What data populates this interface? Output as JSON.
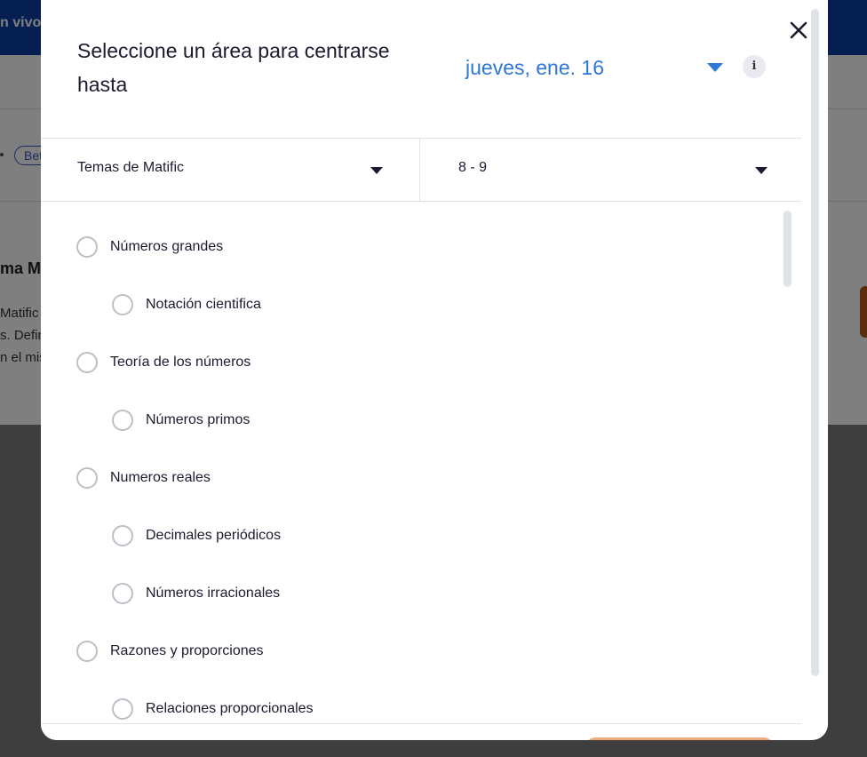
{
  "background": {
    "topbar_text": "n vivo",
    "badge": "Beta",
    "heading": "ma Ma",
    "paragraph_lines": [
      "Matific",
      "s. Defin",
      "n el mis"
    ]
  },
  "modal": {
    "title": "Seleccione un área para centrarse hasta",
    "date": {
      "value": "jueves, ene. 16"
    },
    "info_label": "i",
    "filters": {
      "topic": {
        "value": "Temas de Matific"
      },
      "grade": {
        "value": "8 - 9"
      }
    },
    "topics": [
      {
        "label": "Números grandes",
        "level": 0
      },
      {
        "label": "Notación cientifica",
        "level": 1
      },
      {
        "label": "Teoría de los números",
        "level": 0
      },
      {
        "label": "Números primos",
        "level": 1
      },
      {
        "label": "Numeros reales",
        "level": 0
      },
      {
        "label": "Decimales periódicos",
        "level": 1
      },
      {
        "label": "Números irracionales",
        "level": 1
      },
      {
        "label": "Razones y proporciones",
        "level": 0
      },
      {
        "label": "Relaciones proporcionales",
        "level": 1
      }
    ]
  },
  "colors": {
    "accent": "#2d78d6",
    "topbar": "#0d3fa6",
    "confirm_button": "#f4a979",
    "radio_border": "#bcc0c6"
  }
}
